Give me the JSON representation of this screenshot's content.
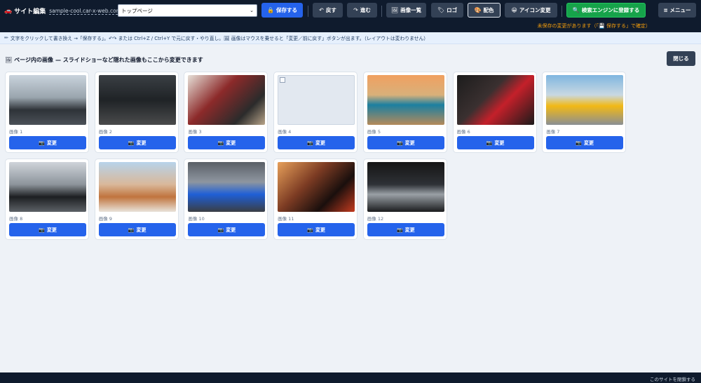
{
  "header": {
    "title": "サイト編集",
    "domain": "sample-cool.car-x-web.com",
    "page_select": "トップページ",
    "buttons": {
      "save": "保存する",
      "undo": "戻す",
      "redo": "進む",
      "image_list": "画像一覧",
      "logo": "ロゴ",
      "colors": "配色",
      "icon_change": "アイコン変更",
      "seo_register": "検索エンジンに登録する",
      "menu": "≡ メニュー"
    },
    "unsaved_notice": "未保存の変更があります（「💾 保存する」で確定）"
  },
  "hint": "文字をクリックして書き換え →「保存する」。↶↷ または Ctrl+Z / Ctrl+Y で元に戻す・やり直し。🖼 画像はマウスを乗せると「変更／前に戻す」ボタンが出ます。（レイアウトは変わりません）",
  "panel": {
    "title": "ページ内の画像",
    "subtitle": "— スライドショーなど隠れた画像もここから変更できます",
    "close_label": "閉じる",
    "change_label": "変更",
    "images": [
      {
        "label": "画像 1"
      },
      {
        "label": "画像 2"
      },
      {
        "label": "画像 3"
      },
      {
        "label": "画像 4"
      },
      {
        "label": "画像 5"
      },
      {
        "label": "画像 6"
      },
      {
        "label": "画像 7"
      },
      {
        "label": "画像 8"
      },
      {
        "label": "画像 9"
      },
      {
        "label": "画像 10"
      },
      {
        "label": "画像 11"
      },
      {
        "label": "画像 12"
      }
    ]
  },
  "footer": {
    "close_site": "このサイトを閉鎖する"
  },
  "colors": {
    "topbar": "#0f1b2d",
    "accent_blue": "#2563eb",
    "accent_green": "#16a34a",
    "warning": "#f59e0b"
  }
}
